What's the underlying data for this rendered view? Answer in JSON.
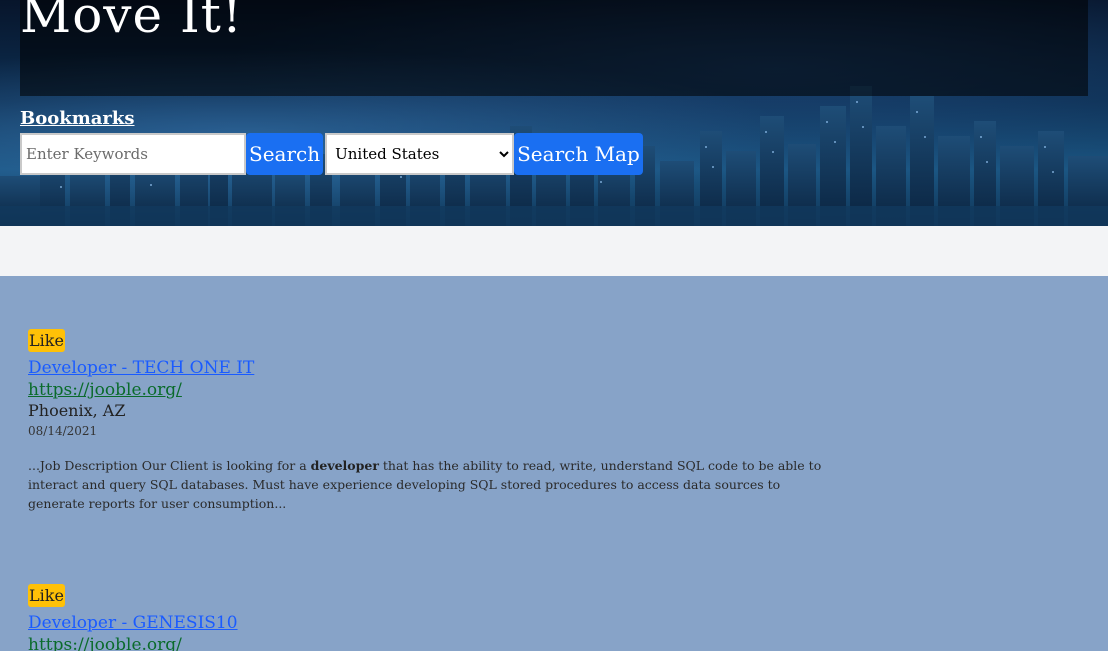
{
  "header": {
    "title": "Move It!",
    "bookmarks_label": "Bookmarks"
  },
  "search": {
    "keywords_placeholder": "Enter Keywords",
    "keywords_value": "",
    "search_label": "Search",
    "country_selected": "United States",
    "search_map_label": "Search Map"
  },
  "jobs": [
    {
      "like_label": "Like",
      "title": "Developer - TECH ONE IT",
      "link": "https://jooble.org/",
      "location": "Phoenix, AZ",
      "date": "08/14/2021",
      "desc_before": " ...Job Description Our Client is looking for a ",
      "desc_bold": "developer",
      "desc_after": " that has the ability to read, write, understand SQL code to be able to interact and query SQL databases. Must have experience developing SQL stored procedures to access data sources to generate reports for user consumption..."
    },
    {
      "like_label": "Like",
      "title": "Developer - GENESIS10",
      "link": "https://jooble.org/"
    }
  ],
  "colors": {
    "accent_button": "#1a6ff2",
    "like_button": "#ffc107",
    "results_background": "#87a3c8",
    "gray_band": "#f3f4f6",
    "job_title_link": "#1a5bff",
    "job_url_link": "#0a6b2b"
  }
}
